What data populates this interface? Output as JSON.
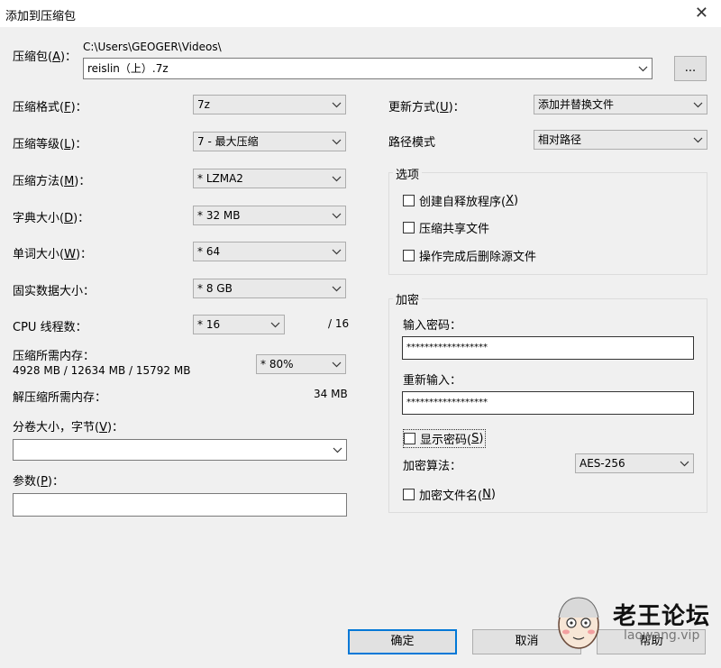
{
  "window": {
    "title": "添加到压缩包"
  },
  "archive": {
    "label": "压缩包(",
    "label_key": "A",
    "label_end": ")：",
    "path": "C:\\Users\\GEOGER\\Videos\\",
    "filename": "reislin（上）.7z",
    "browse_label": "..."
  },
  "left": {
    "format_label": "压缩格式(",
    "format_key": "F",
    "format_end": ")：",
    "format_value": "7z",
    "level_label": "压缩等级(",
    "level_key": "L",
    "level_end": ")：",
    "level_value": "7 - 最大压缩",
    "method_label": "压缩方法(",
    "method_key": "M",
    "method_end": ")：",
    "method_value": "* LZMA2",
    "dict_label": "字典大小(",
    "dict_key": "D",
    "dict_end": ")：",
    "dict_value": "* 32 MB",
    "word_label": "单词大小(",
    "word_key": "W",
    "word_end": ")：",
    "word_value": "* 64",
    "solid_label": "固实数据大小：",
    "solid_value": "* 8 GB",
    "cpu_label": "CPU 线程数：",
    "cpu_value": "* 16",
    "cpu_max": "/ 16",
    "mem_label": "压缩所需内存：",
    "mem_values": "4928 MB / 12634 MB / 15792 MB",
    "mem_percent": "* 80%",
    "decomp_label": "解压缩所需内存：",
    "decomp_value": "34 MB",
    "volume_label": "分卷大小，字节(",
    "volume_key": "V",
    "volume_end": ")：",
    "volume_value": "",
    "params_label": "参数(",
    "params_key": "P",
    "params_end": ")：",
    "params_value": ""
  },
  "right": {
    "update_label": "更新方式(",
    "update_key": "U",
    "update_end": ")：",
    "update_value": "添加并替换文件",
    "path_label": "路径模式",
    "path_value": "相对路径",
    "options_title": "选项",
    "opt_sfx": "创建自释放程序(",
    "opt_sfx_key": "X",
    "opt_sfx_end": ")",
    "opt_shared": "压缩共享文件",
    "opt_delete": "操作完成后删除源文件",
    "encrypt_title": "加密",
    "pwd_label": "输入密码：",
    "pwd_value": "******************",
    "repwd_label": "重新输入：",
    "repwd_value": "******************",
    "show_pwd": "显示密码(",
    "show_pwd_key": "S",
    "show_pwd_end": ")",
    "algo_label": "加密算法：",
    "algo_value": "AES-256",
    "enc_names": "加密文件名(",
    "enc_names_key": "N",
    "enc_names_end": ")"
  },
  "buttons": {
    "ok": "确定",
    "cancel": "取消",
    "help": "帮助"
  },
  "watermark": {
    "text": "老王论坛",
    "url": "laowang.vip"
  },
  "colors": {
    "focus": "#0078d7",
    "bg": "#f0f0f0"
  }
}
